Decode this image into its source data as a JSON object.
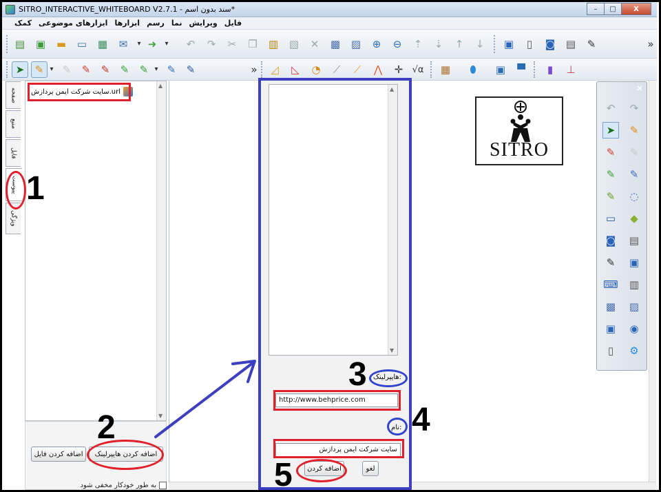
{
  "window": {
    "title": "SITRO_INTERACTIVE_WHITEBOARD V2.7.1 - سند بدون اسم*",
    "controls": {
      "minimize": "–",
      "maximize": "□",
      "close": "X"
    }
  },
  "menu": {
    "items": [
      "فایل",
      "ویرایش",
      "نما",
      "رسم",
      "ابزارها",
      "ابزارهای موضوعی",
      "کمک"
    ]
  },
  "toolbar": {
    "overflow_main": "»",
    "overflow_secondary": "»",
    "dropdown": "▾"
  },
  "left_tabs": [
    "صفحه",
    "منبع",
    "فایل",
    "پیوست",
    "ویژگی"
  ],
  "attachments": {
    "items": [
      {
        "label": "سایت شرکت ایمن پردازش.url"
      }
    ],
    "add_hyperlink_button": "اضافه کردن هایپرلینک",
    "add_file_button": "اضافه کردن فایل",
    "auto_hide_label": "به طور خودکار مخفی شود",
    "scroll_up": "▲",
    "scroll_down": "▼"
  },
  "dialog": {
    "hyperlink_label": "هایپرلینک:",
    "hyperlink_value": "http://www.behprice.com",
    "name_label": "نام:",
    "name_value": "سایت شرکت ایمن پردازش",
    "add_button": "اضافه کردن",
    "cancel_button": "لغو",
    "scroll_up": "▲",
    "scroll_down": "▼"
  },
  "logo": {
    "text": "SITRO"
  },
  "floating_toolbar": {
    "close": "×"
  },
  "annotations": {
    "step1": "1",
    "step2": "2",
    "step3": "3",
    "step4": "4",
    "step5": "5"
  },
  "colors": {
    "annotation_red": "#e0202a",
    "annotation_blue": "#3b3fc0"
  }
}
